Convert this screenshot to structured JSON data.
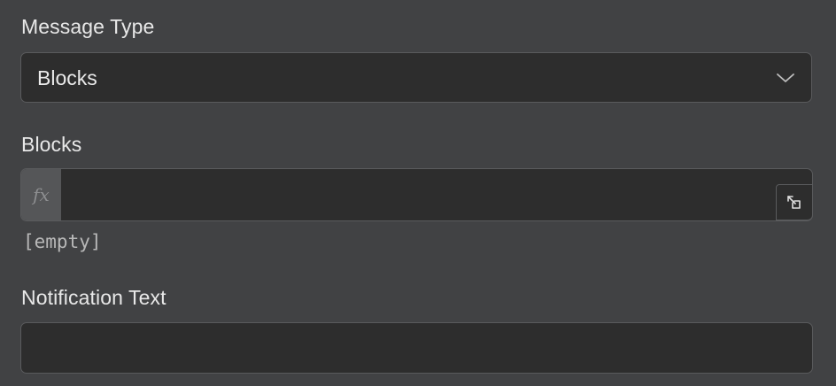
{
  "fields": {
    "message_type": {
      "label": "Message Type",
      "value": "Blocks",
      "icon": "chevron-down-icon"
    },
    "blocks": {
      "label": "Blocks",
      "fx_label": "fx",
      "value": "",
      "empty_hint": "[empty]",
      "expand_icon": "expand-icon"
    },
    "notification_text": {
      "label": "Notification Text",
      "value": ""
    }
  },
  "colors": {
    "background": "#414244",
    "input_bg": "#2d2d2d",
    "border": "#5a5b5d",
    "fx_bg": "#555658"
  }
}
